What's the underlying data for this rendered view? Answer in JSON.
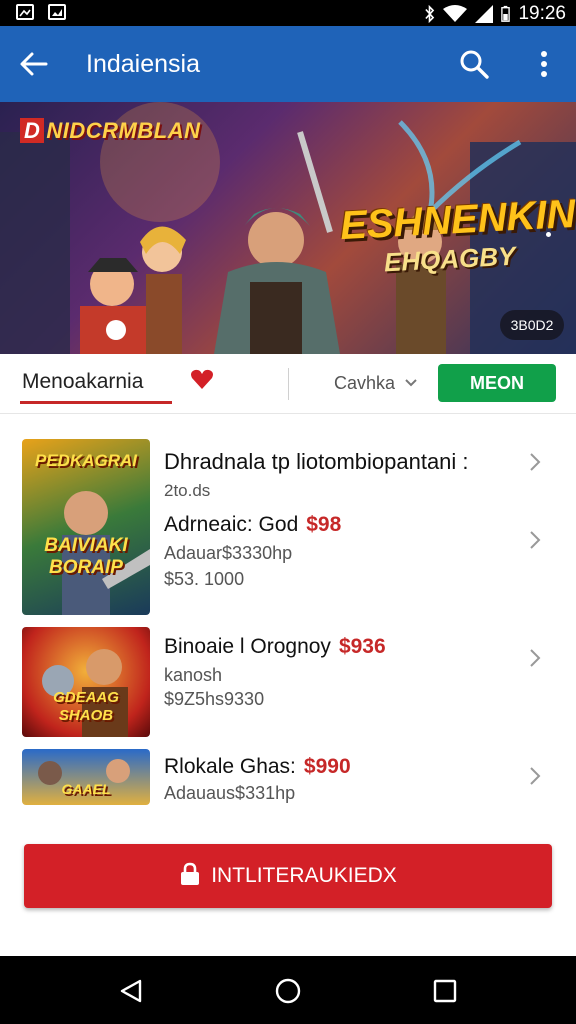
{
  "status_bar": {
    "time": "19:26",
    "icons": [
      "image-icon",
      "bluetooth-icon",
      "wifi-icon",
      "signal-icon",
      "battery-icon"
    ]
  },
  "app_bar": {
    "title": "Indaiensia",
    "icons": [
      "back-arrow-icon",
      "search-icon",
      "more-vert-icon"
    ]
  },
  "banner": {
    "tag_lead": "D",
    "tag": "NIDCRMBLAN",
    "headline": "ESHNENKIN",
    "subheadline": "EHQAGBY",
    "count": "3B0D2"
  },
  "tabs": {
    "active_tab": "Menoakarnia",
    "sort_label": "Cavhka",
    "action_button": "MEON",
    "accent": "#c62828",
    "button_color": "#11a04a"
  },
  "products": [
    {
      "thumb_text": [
        "PEDKAGRAI",
        "BAIVIAKI",
        "BORAIP"
      ],
      "title": "Dhradnala tp liotombiopantani :",
      "line2": "2to.ds",
      "name": "Adrneaic: God",
      "price": "$98",
      "line4": "Adauar$3330hp",
      "line5": "$53. 1000"
    },
    {
      "thumb_text": [
        "GDEAAG",
        "SHAOB"
      ],
      "title": "Binoaie l Orognoy",
      "price": "$936",
      "line2": "kanosh",
      "line3": "$9Z5hs9330"
    },
    {
      "thumb_text": [
        "GAAEL"
      ],
      "title": "Rlokale Ghas:",
      "price": "$990",
      "line2": "Adauaus$331hp"
    }
  ],
  "cta": {
    "label": "INTLITERAUKIEDX",
    "color": "#d32027"
  },
  "nav_bar": {
    "icons": [
      "back-triangle-icon",
      "home-circle-icon",
      "recents-square-icon"
    ]
  }
}
